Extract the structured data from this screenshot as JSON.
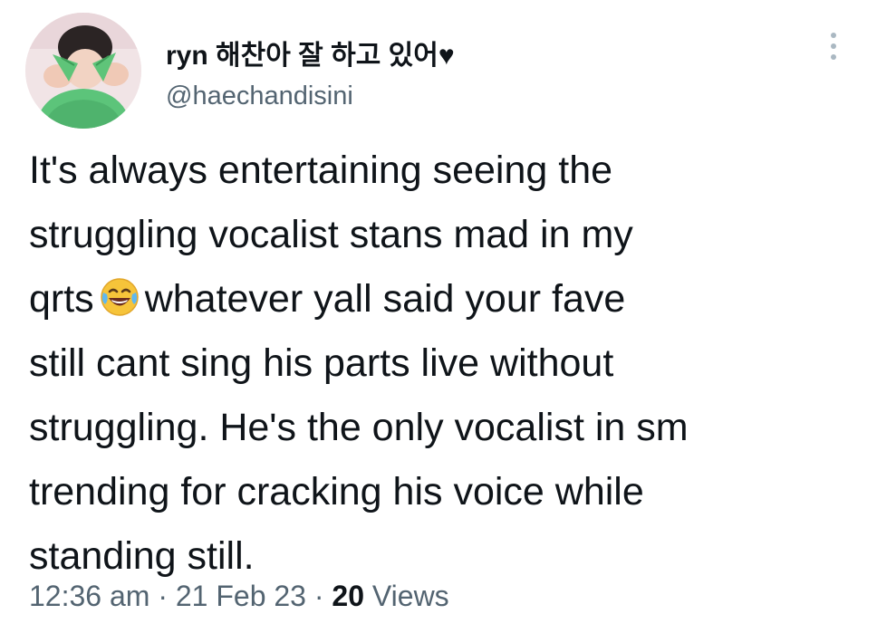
{
  "tweet": {
    "author": {
      "display_name": "ryn 해찬아 잘 하고 있어♥",
      "handle": "@haechandisini"
    },
    "text_before_emoji": "It's always entertaining seeing the\nstruggling vocalist stans mad in my\nqrts",
    "emoji": "face-with-tears-of-joy",
    "text_after_emoji": "whatever yall said your fave\nstill cant sing his parts live without\nstruggling. He's the only vocalist in sm\ntrending for cracking his voice while\nstanding still.",
    "time": "12:36 am",
    "date": "21 Feb 23",
    "separator": "·",
    "views_count": "20",
    "views_label": "Views"
  },
  "colors": {
    "text": "#0f1419",
    "secondary": "#536471",
    "avatar_sweater": "#5cc47a"
  },
  "icons": {
    "more": "more-vertical-icon"
  }
}
